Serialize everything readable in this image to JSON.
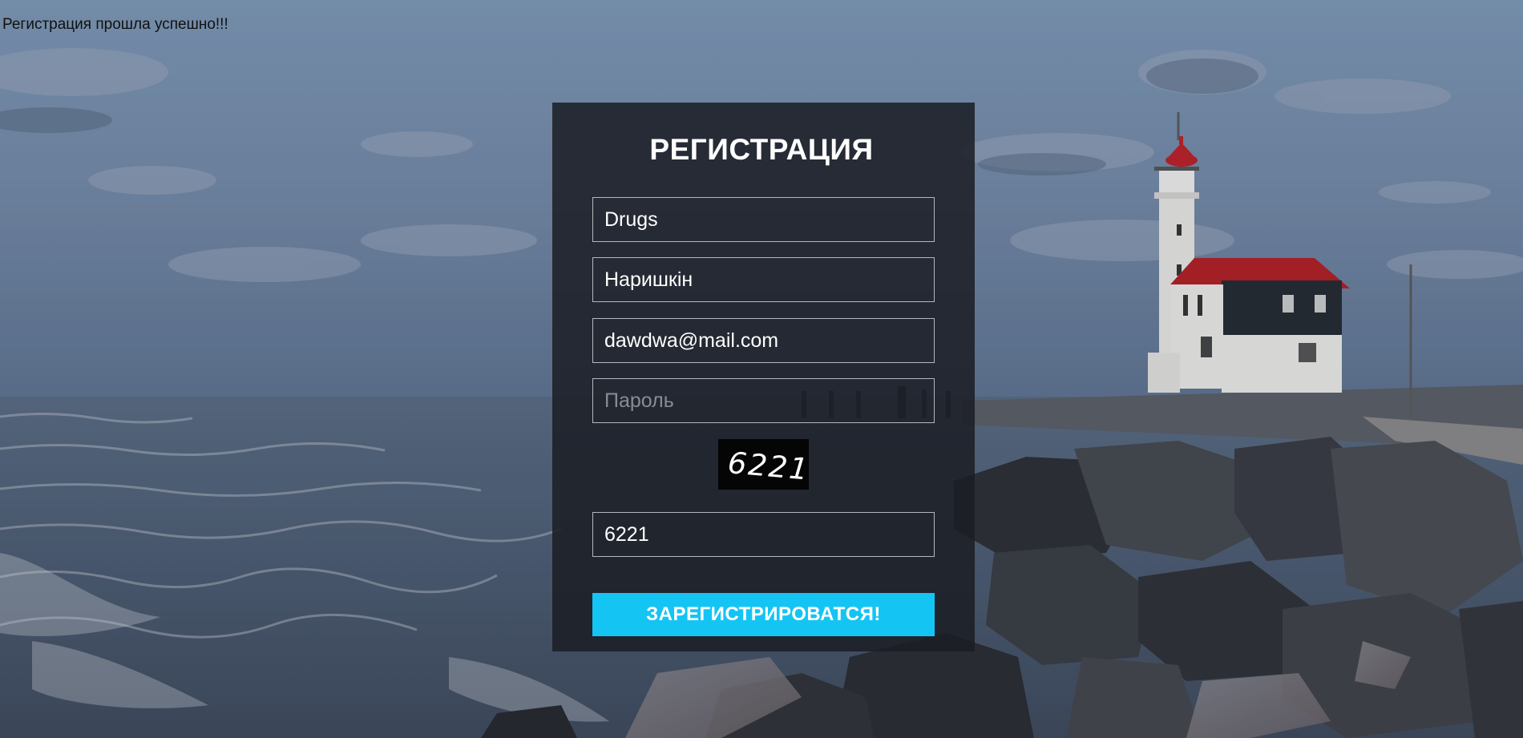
{
  "status": {
    "message": "Регистрация прошла успешно!!!"
  },
  "form": {
    "title": "РЕГИСТРАЦИЯ",
    "fields": {
      "first_name": {
        "value": "Drugs"
      },
      "last_name": {
        "value": "Наришкін"
      },
      "email": {
        "value": "dawdwa@mail.com"
      },
      "password": {
        "value": "",
        "placeholder": "Пароль"
      },
      "captcha_answer": {
        "value": "6221"
      }
    },
    "captcha": {
      "code": "6221"
    },
    "submit_label": "ЗАРЕГИСТРИРОВАТСЯ!"
  },
  "colors": {
    "panel_bg": "#1b1d24",
    "accent": "#14c5f4",
    "field_border": "#b5b7bd",
    "text": "#ffffff"
  },
  "background": {
    "scene": "seaside lighthouse at dusk with rocky shore"
  }
}
